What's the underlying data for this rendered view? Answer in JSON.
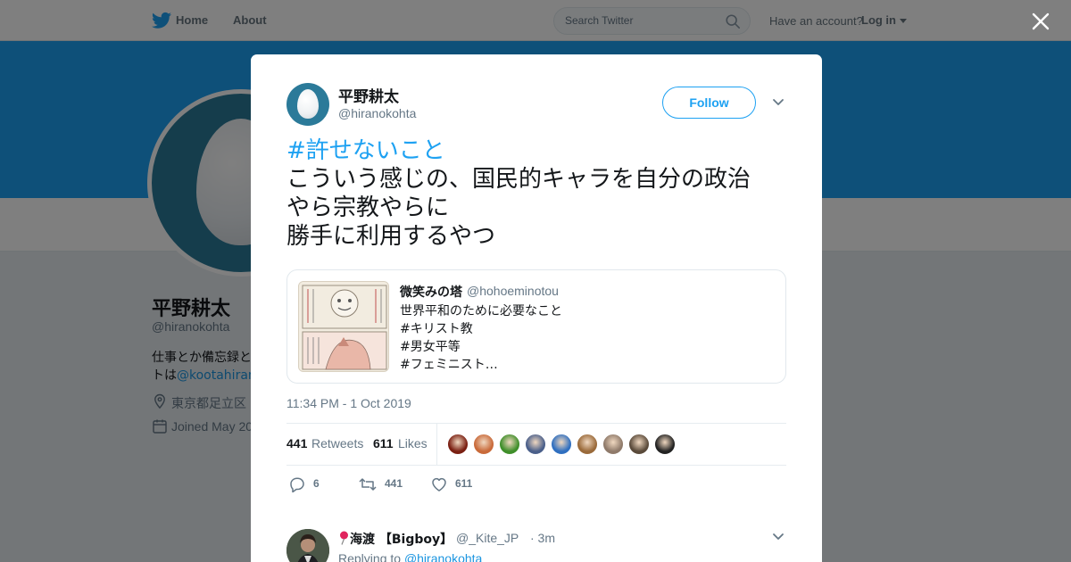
{
  "topbar": {
    "home": "Home",
    "about": "About",
    "search_placeholder": "Search Twitter",
    "have_account": "Have an account?",
    "login": "Log in"
  },
  "profile": {
    "name": "平野耕太",
    "handle": "@hiranokohta",
    "bio_line1": "仕事とか備忘録と",
    "bio_line2_prefix": "トは",
    "bio_link": "@kootahiranc",
    "location": "東京都足立区",
    "joined": "Joined May 20"
  },
  "tweet": {
    "author_name": "平野耕太",
    "author_handle": "@hiranokohta",
    "follow_label": "Follow",
    "hashtag": "#許せないこと",
    "lines": [
      "こういう感じの、国民的キャラを自分の政治",
      "やら宗教やらに",
      "勝手に利用するやつ"
    ],
    "quoted": {
      "name": "微笑みの塔",
      "handle": "@hohoeminotou",
      "lines": [
        "世界平和のために必要なこと",
        "#キリスト教",
        "#男女平等",
        "#フェミニスト…"
      ]
    },
    "timestamp": "11:34 PM - 1 Oct 2019",
    "retweets_count": "441",
    "retweets_label": "Retweets",
    "likes_count": "611",
    "likes_label": "Likes",
    "actions": {
      "reply_count": "6",
      "retweet_count": "441",
      "like_count": "611"
    },
    "liker_colors": [
      "#7a1f12",
      "#c96a3a",
      "#3f8f2a",
      "#4a5f8a",
      "#2f6fc0",
      "#9a6a3a",
      "#8f7a6a",
      "#5a4a3a",
      "#222222"
    ]
  },
  "reply": {
    "name": "海渡 【Bigboy】",
    "handle": "@_Kite_JP",
    "time": "· 3m",
    "replying_prefix": "Replying to",
    "replying_handle": "@hiranokohta"
  },
  "colors": {
    "accent": "#1da1f2",
    "banner": "#1da1f2",
    "link": "#1b95e0"
  }
}
